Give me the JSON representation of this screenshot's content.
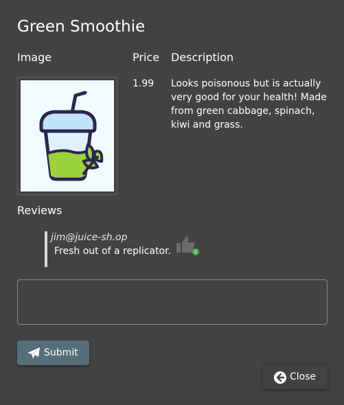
{
  "dialog": {
    "title": "Green Smoothie",
    "columns": {
      "image": "Image",
      "price": "Price",
      "description": "Description"
    },
    "product": {
      "price": "1.99",
      "description": "Looks poisonous but is actually very good for your health! Made from green cabbage, spinach, kiwi and grass."
    },
    "reviews_heading": "Reviews",
    "reviews": [
      {
        "author": "jim@juice-sh.op",
        "text": "Fresh out of a replicator.",
        "likes": "1"
      }
    ],
    "review_input": {
      "value": "",
      "placeholder": ""
    },
    "submit_label": "Submit",
    "close_label": "Close",
    "icons": {
      "submit": "paper-plane-icon",
      "close": "arrow-circle-left-icon",
      "like": "thumbs-up-icon"
    },
    "colors": {
      "background": "#424242",
      "submit_button": "#546e7a",
      "like_badge": "#4caf50"
    }
  }
}
